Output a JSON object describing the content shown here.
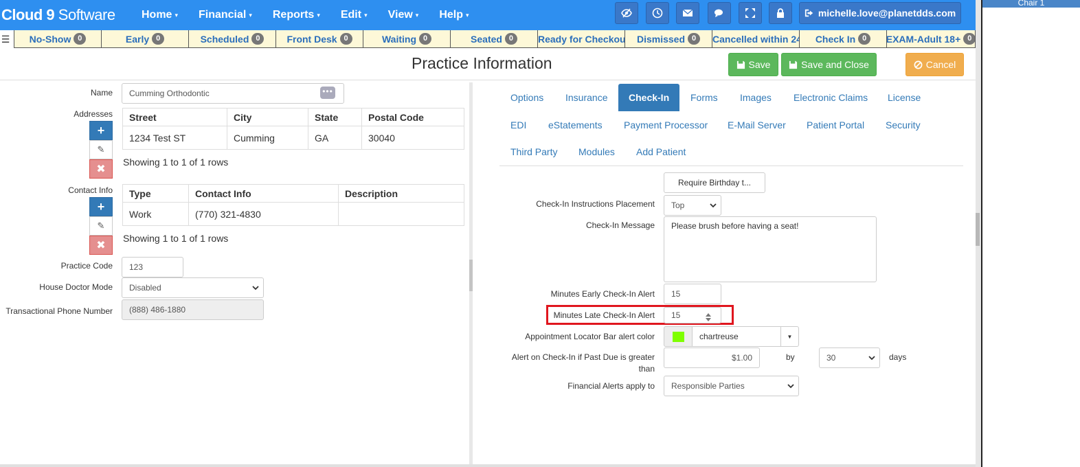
{
  "brand": {
    "name": "Cloud 9",
    "suffix": " Software"
  },
  "nav": {
    "menus": [
      {
        "label": "Home"
      },
      {
        "label": "Financial"
      },
      {
        "label": "Reports"
      },
      {
        "label": "Edit"
      },
      {
        "label": "View"
      },
      {
        "label": "Help"
      }
    ],
    "icons": [
      "eye-slash-icon",
      "clock-icon",
      "envelope-icon",
      "chat-icon",
      "expand-icon",
      "lock-icon"
    ],
    "user_email": "michelle.love@planetdds.com"
  },
  "side_panel": {
    "chair_label": "Chair 1"
  },
  "status_bar": [
    {
      "label": "No-Show",
      "count": "0"
    },
    {
      "label": "Early",
      "count": "0"
    },
    {
      "label": "Scheduled",
      "count": "0"
    },
    {
      "label": "Front Desk",
      "count": "0"
    },
    {
      "label": "Waiting",
      "count": "0"
    },
    {
      "label": "Seated",
      "count": "0"
    },
    {
      "label": "Ready for Checkout",
      "count": ""
    },
    {
      "label": "Dismissed",
      "count": "0"
    },
    {
      "label": "Cancelled within 24",
      "count": ""
    },
    {
      "label": "Check In",
      "count": "0"
    },
    {
      "label": "EXAM-Adult 18+",
      "count": "0"
    }
  ],
  "page": {
    "title": "Practice Information",
    "save_label": "Save",
    "save_close_label": "Save and Close",
    "cancel_label": "Cancel"
  },
  "left_form": {
    "name_label": "Name",
    "name_value": "Cumming Orthodontic",
    "ellipsis": "•••",
    "addresses_label": "Addresses",
    "address_table": {
      "headers": [
        "Street",
        "City",
        "State",
        "Postal Code"
      ],
      "rows": [
        [
          "1234 Test ST",
          "Cumming",
          "GA",
          "30040"
        ]
      ],
      "showing": "Showing 1 to 1 of 1 rows"
    },
    "contact_label": "Contact Info",
    "contact_table": {
      "headers": [
        "Type",
        "Contact Info",
        "Description"
      ],
      "rows": [
        [
          "Work",
          "(770) 321-4830",
          ""
        ]
      ],
      "showing": "Showing 1 to 1 of 1 rows"
    },
    "practice_code_label": "Practice Code",
    "practice_code_value": "123",
    "house_doctor_label": "House Doctor Mode",
    "house_doctor_value": "Disabled",
    "transactional_phone_label": "Transactional Phone Number",
    "transactional_phone_value": "(888) 486-1880"
  },
  "tabs": [
    {
      "label": "Options",
      "active": false
    },
    {
      "label": "Insurance",
      "active": false
    },
    {
      "label": "Check-In",
      "active": true
    },
    {
      "label": "Forms",
      "active": false
    },
    {
      "label": "Images",
      "active": false
    },
    {
      "label": "Electronic Claims",
      "active": false
    },
    {
      "label": "License",
      "active": false
    },
    {
      "label": "EDI",
      "active": false
    },
    {
      "label": "eStatements",
      "active": false
    },
    {
      "label": "Payment Processor",
      "active": false
    },
    {
      "label": "E-Mail Server",
      "active": false
    },
    {
      "label": "Patient Portal",
      "active": false
    },
    {
      "label": "Security",
      "active": false
    },
    {
      "label": "Third Party",
      "active": false
    },
    {
      "label": "Modules",
      "active": false
    },
    {
      "label": "Add Patient",
      "active": false
    }
  ],
  "checkin": {
    "require_birthday_button": "Require Birthday t...",
    "instructions_placement_label": "Check-In Instructions Placement",
    "instructions_placement_value": "Top",
    "message_label": "Check-In Message",
    "message_value": "Please brush before having a seat!",
    "minutes_early_label": "Minutes Early Check-In Alert",
    "minutes_early_value": "15",
    "minutes_late_label": "Minutes Late Check-In Alert",
    "minutes_late_value": "15",
    "locator_color_label": "Appointment Locator Bar alert color",
    "locator_color_value": "chartreuse",
    "locator_color_hex": "#7fff00",
    "past_due_label_line1": "Alert on Check-In if Past Due is greater",
    "past_due_label_line2": "than",
    "past_due_amount": "$1.00",
    "past_due_by_label": "by",
    "past_due_days_value": "30",
    "past_due_days_label": "days",
    "financial_alerts_label": "Financial Alerts apply to",
    "financial_alerts_value": "Responsible Parties"
  },
  "colors": {
    "navbar": "#2e8ff0",
    "status_bg": "#fdf8d8",
    "link": "#337ab7",
    "success": "#5cb85c",
    "warning": "#f0ad4e",
    "highlight": "#e0161e"
  }
}
